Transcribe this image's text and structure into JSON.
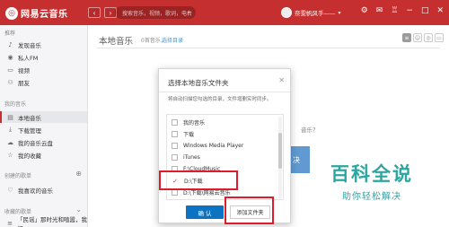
{
  "topbar": {
    "logo_text": "网易云音乐",
    "search_placeholder": "搜索音乐，视频，歌词，电台",
    "username": "奈雯帆风手——",
    "back_icon": "chevron-left-icon",
    "forward_icon": "chevron-right-icon",
    "icons": [
      "gear-icon",
      "mail-icon",
      "shirt-icon",
      "minimize-icon",
      "maximize-icon",
      "close-icon"
    ]
  },
  "sidebar": {
    "recommend_title": "推荐",
    "recommend_items": [
      {
        "label": "发现音乐",
        "icon": "music-note-icon"
      },
      {
        "label": "私人FM",
        "icon": "radio-icon"
      },
      {
        "label": "视频",
        "icon": "video-icon"
      },
      {
        "label": "朋友",
        "icon": "friends-icon"
      }
    ],
    "mymusic_title": "我的音乐",
    "mymusic_items": [
      {
        "label": "本地音乐",
        "icon": "local-music-icon",
        "active": true
      },
      {
        "label": "下载管理",
        "icon": "download-icon"
      },
      {
        "label": "我的音乐云盘",
        "icon": "cloud-icon"
      },
      {
        "label": "我的收藏",
        "icon": "collection-icon"
      }
    ],
    "created_title": "创建的歌单",
    "created_items": [
      {
        "label": "我喜欢的音乐",
        "icon": "heart-icon"
      }
    ],
    "collected_title": "收藏的歌单",
    "collected_items": [
      {
        "label": "「民谣」那时光和喧嚣，我们..."
      }
    ]
  },
  "main": {
    "title": "本地音乐",
    "count": "0首音乐，",
    "choose_dir": "选择目录",
    "bg_text": "音乐？",
    "bg_button": "决"
  },
  "dialog": {
    "title": "选择本地音乐文件夹",
    "description": "将自动扫描您勾选的目录，文件增删实时同步。",
    "folders": [
      {
        "label": "我的音乐",
        "checked": false
      },
      {
        "label": "下载",
        "checked": false
      },
      {
        "label": "Windows Media Player",
        "checked": false
      },
      {
        "label": "iTunes",
        "checked": false
      },
      {
        "label": "F:\\CloudMusic",
        "checked": false
      },
      {
        "label": "D:\\下载",
        "checked": true
      },
      {
        "label": "D:\\下载\\网易云音乐",
        "checked": false
      }
    ],
    "ok_label": "确 认",
    "add_folder_label": "添加文件夹"
  },
  "watermark": {
    "title": "百科全说",
    "subtitle": "助你轻松解决"
  },
  "colors": {
    "brand_red": "#c62f2f",
    "link_blue": "#0c73c2",
    "highlight_red": "#e01b2a",
    "watermark_teal": "#2ba6a0"
  }
}
